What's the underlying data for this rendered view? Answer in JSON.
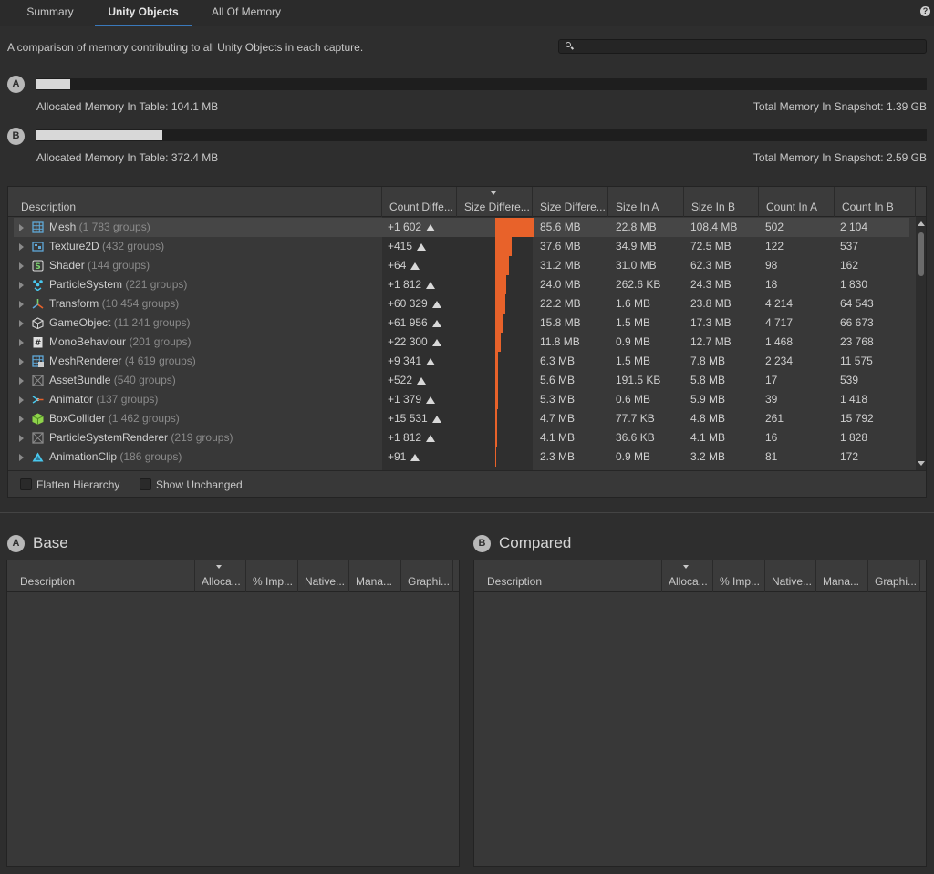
{
  "tabs": [
    "Summary",
    "Unity Objects",
    "All Of Memory"
  ],
  "active_tab": "Unity Objects",
  "help_label": "?",
  "description": "A comparison of memory contributing to all Unity Objects in each capture.",
  "search": {
    "placeholder": ""
  },
  "snapshots": {
    "a": {
      "badge": "A",
      "allocated": "Allocated Memory In Table: 104.1 MB",
      "total": "Total Memory In Snapshot: 1.39 GB",
      "fill_fraction": 0.038
    },
    "b": {
      "badge": "B",
      "allocated": "Allocated Memory In Table: 372.4 MB",
      "total": "Total Memory In Snapshot: 2.59 GB",
      "fill_fraction": 0.141
    }
  },
  "table": {
    "columns": [
      "Description",
      "Count Diffe...",
      "Size Differe...",
      "Size Differe...",
      "Size In A",
      "Size In B",
      "Count In A",
      "Count In B"
    ],
    "rows": [
      {
        "name": "Mesh",
        "groups": "(1 783 groups)",
        "count_diff": "+1 602",
        "diff_fraction": 1.0,
        "size_diff": "85.6 MB",
        "size_a": "22.8 MB",
        "size_b": "108.4 MB",
        "count_a": "502",
        "count_b": "2 104",
        "icon": "mesh-icon",
        "color": "#5fa8d8"
      },
      {
        "name": "Texture2D",
        "groups": "(432 groups)",
        "count_diff": "+415",
        "diff_fraction": 0.44,
        "size_diff": "37.6 MB",
        "size_a": "34.9 MB",
        "size_b": "72.5 MB",
        "count_a": "122",
        "count_b": "537",
        "icon": "texture-icon",
        "color": "#5fa8d8"
      },
      {
        "name": "Shader",
        "groups": "(144 groups)",
        "count_diff": "+64",
        "diff_fraction": 0.36,
        "size_diff": "31.2 MB",
        "size_a": "31.0 MB",
        "size_b": "62.3 MB",
        "count_a": "98",
        "count_b": "162",
        "icon": "shader-icon",
        "color": "#e0e0e0"
      },
      {
        "name": "ParticleSystem",
        "groups": "(221 groups)",
        "count_diff": "+1 812",
        "diff_fraction": 0.28,
        "size_diff": "24.0 MB",
        "size_a": "262.6 KB",
        "size_b": "24.3 MB",
        "count_a": "18",
        "count_b": "1 830",
        "icon": "particle-system-icon",
        "color": "#49c8ee"
      },
      {
        "name": "Transform",
        "groups": "(10 454 groups)",
        "count_diff": "+60 329",
        "diff_fraction": 0.26,
        "size_diff": "22.2 MB",
        "size_a": "1.6 MB",
        "size_b": "23.8 MB",
        "count_a": "4 214",
        "count_b": "64 543",
        "icon": "transform-icon",
        "color": "#e7a83c"
      },
      {
        "name": "GameObject",
        "groups": "(11 241 groups)",
        "count_diff": "+61 956",
        "diff_fraction": 0.18,
        "size_diff": "15.8 MB",
        "size_a": "1.5 MB",
        "size_b": "17.3 MB",
        "count_a": "4 717",
        "count_b": "66 673",
        "icon": "gameobject-icon",
        "color": "#cfcfcf"
      },
      {
        "name": "MonoBehaviour",
        "groups": "(201 groups)",
        "count_diff": "+22 300",
        "diff_fraction": 0.14,
        "size_diff": "11.8 MB",
        "size_a": "0.9 MB",
        "size_b": "12.7 MB",
        "count_a": "1 468",
        "count_b": "23 768",
        "icon": "script-icon",
        "color": "#e0e0e0"
      },
      {
        "name": "MeshRenderer",
        "groups": "(4 619 groups)",
        "count_diff": "+9 341",
        "diff_fraction": 0.07,
        "size_diff": "6.3 MB",
        "size_a": "1.5 MB",
        "size_b": "7.8 MB",
        "count_a": "2 234",
        "count_b": "11 575",
        "icon": "mesh-renderer-icon",
        "color": "#5fa8d8"
      },
      {
        "name": "AssetBundle",
        "groups": "(540 groups)",
        "count_diff": "+522",
        "diff_fraction": 0.065,
        "size_diff": "5.6 MB",
        "size_a": "191.5 KB",
        "size_b": "5.8 MB",
        "count_a": "17",
        "count_b": "539",
        "icon": "asset-bundle-icon",
        "color": "#8a8a8a"
      },
      {
        "name": "Animator",
        "groups": "(137 groups)",
        "count_diff": "+1 379",
        "diff_fraction": 0.062,
        "size_diff": "5.3 MB",
        "size_a": "0.6 MB",
        "size_b": "5.9 MB",
        "count_a": "39",
        "count_b": "1 418",
        "icon": "animator-icon",
        "color": "#49c8ee"
      },
      {
        "name": "BoxCollider",
        "groups": "(1 462 groups)",
        "count_diff": "+15 531",
        "diff_fraction": 0.055,
        "size_diff": "4.7 MB",
        "size_a": "77.7 KB",
        "size_b": "4.8 MB",
        "count_a": "261",
        "count_b": "15 792",
        "icon": "box-collider-icon",
        "color": "#8ed34a"
      },
      {
        "name": "ParticleSystemRenderer",
        "groups": "(219 groups)",
        "count_diff": "+1 812",
        "diff_fraction": 0.048,
        "size_diff": "4.1 MB",
        "size_a": "36.6 KB",
        "size_b": "4.1 MB",
        "count_a": "16",
        "count_b": "1 828",
        "icon": "particle-renderer-icon",
        "color": "#8a8a8a"
      },
      {
        "name": "AnimationClip",
        "groups": "(186 groups)",
        "count_diff": "+91",
        "diff_fraction": 0.027,
        "size_diff": "2.3 MB",
        "size_a": "0.9 MB",
        "size_b": "3.2 MB",
        "count_a": "81",
        "count_b": "172",
        "icon": "animation-clip-icon",
        "color": "#49c8ee"
      }
    ]
  },
  "options": {
    "flatten": "Flatten Hierarchy",
    "show_unchanged": "Show Unchanged"
  },
  "base_panel": {
    "badge": "A",
    "title": "Base",
    "columns": [
      "Description",
      "Alloca...",
      "% Imp...",
      "Native...",
      "Mana...",
      "Graphi..."
    ]
  },
  "compared_panel": {
    "badge": "B",
    "title": "Compared",
    "columns": [
      "Description",
      "Alloca...",
      "% Imp...",
      "Native...",
      "Mana...",
      "Graphi..."
    ]
  }
}
